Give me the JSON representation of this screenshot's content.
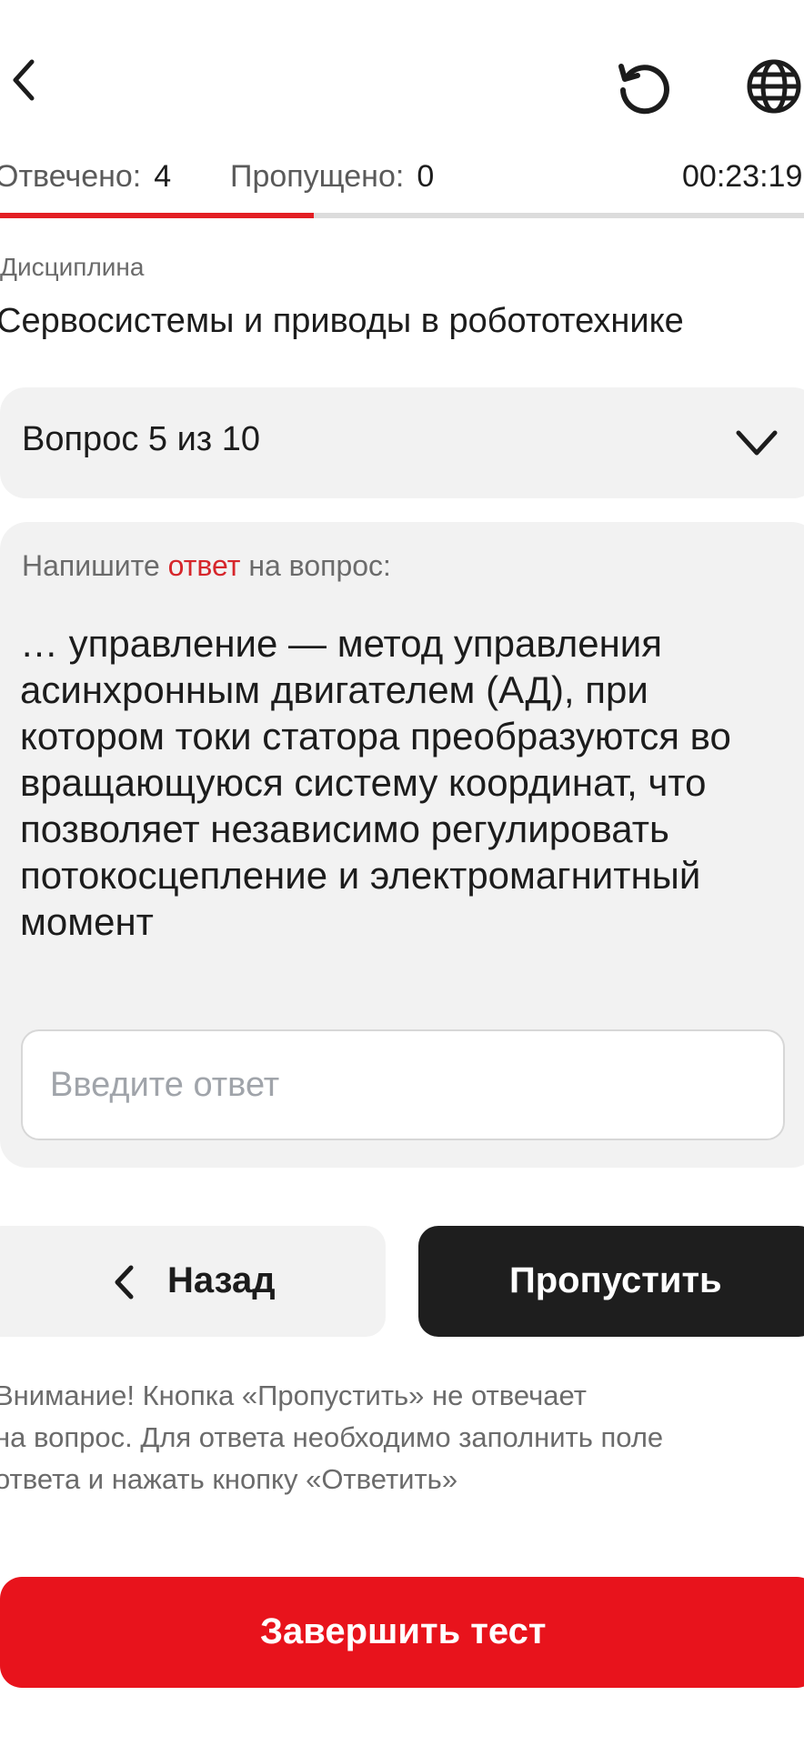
{
  "header": {
    "back_icon": "chevron-left-icon",
    "restart_icon": "restart-icon",
    "language_icon": "globe-icon"
  },
  "stats": {
    "answered_label": "Отвечено:",
    "answered_value": "4",
    "skipped_label": "Пропущено:",
    "skipped_value": "0",
    "timer": "00:23:19"
  },
  "progress": {
    "fraction": 0.39,
    "accent_color": "#e31e24"
  },
  "discipline": {
    "label": "Дисциплина",
    "title": "Сервосистемы и приводы в робототехнике"
  },
  "question_selector": {
    "selected": "Вопрос 5 из 10"
  },
  "question": {
    "prompt_before": "Напишите ",
    "prompt_highlight": "ответ",
    "prompt_after": " на вопрос:",
    "text": "… управление — метод управления асинхронным двигателем (АД), при котором токи статора преобразуются во вращающуюся систему координат, что позволяет независимо регулировать потокосцепление и электромагнитный момент",
    "answer_value": "",
    "answer_placeholder": "Введите ответ"
  },
  "actions": {
    "back_label": "Назад",
    "skip_label": "Пропустить",
    "finish_label": "Завершить тест"
  },
  "notice": {
    "line1": "Внимание! Кнопка «Пропустить» не отвечает",
    "line2": "на вопрос. Для ответа необходимо заполнить поле",
    "line3": "ответа и нажать кнопку «Ответить»"
  }
}
